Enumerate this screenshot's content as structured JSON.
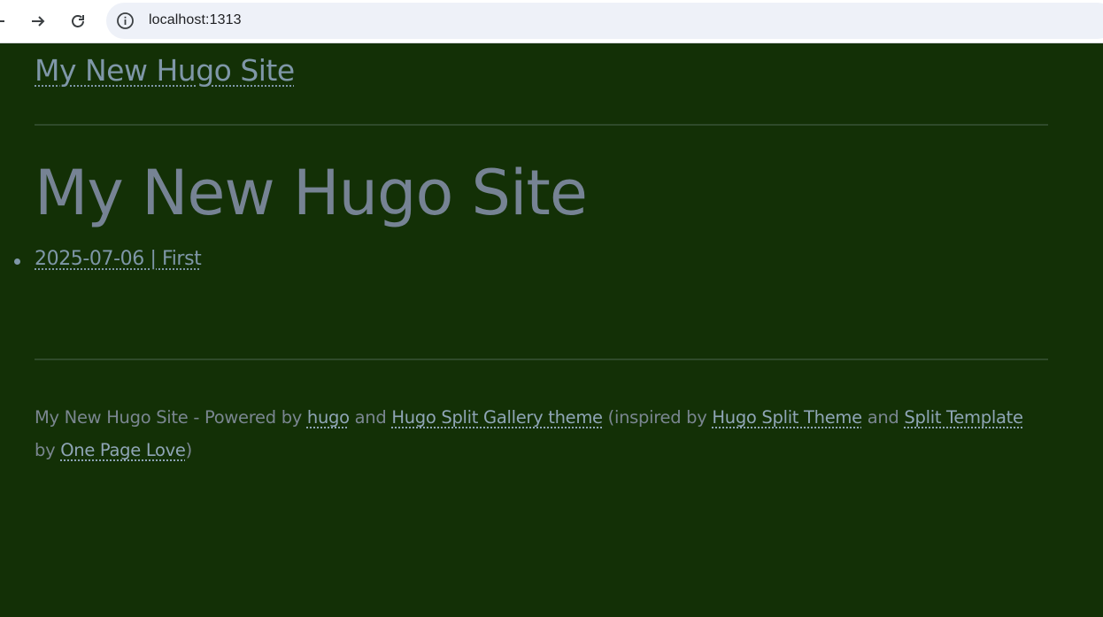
{
  "browser": {
    "url": "localhost:1313",
    "back_icon": "back-arrow-icon",
    "forward_icon": "forward-arrow-icon",
    "reload_icon": "reload-icon",
    "site_info_icon": "info-icon"
  },
  "header": {
    "site_title": "My New Hugo Site"
  },
  "main": {
    "heading": "My New Hugo Site",
    "posts": [
      {
        "label": "2025-07-06 | First"
      }
    ]
  },
  "footer": {
    "prefix": "My New Hugo Site - Powered by ",
    "hugo_link": "hugo",
    "and_1": " and ",
    "gallery_theme_link": "Hugo Split Gallery theme",
    "inspired_by": " (inspired by ",
    "split_theme_link": "Hugo Split Theme",
    "and_2": " and ",
    "split_template_link": "Split Template",
    "by": " by ",
    "one_page_love_link": "One Page Love",
    "suffix": ")"
  },
  "colors": {
    "background": "#133006",
    "link": "#7f97a8",
    "heading": "#768394",
    "footer_text": "#7a8690",
    "divider": "#2f4a2a"
  }
}
